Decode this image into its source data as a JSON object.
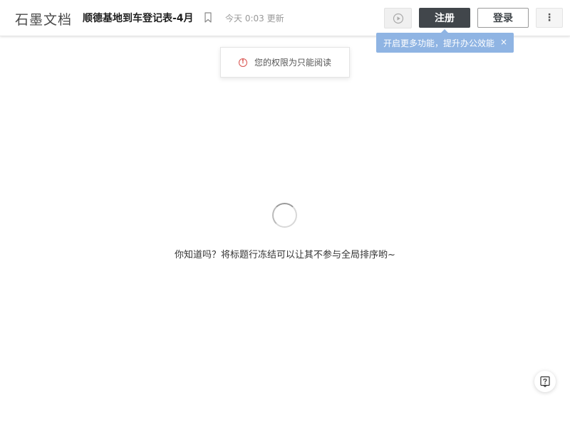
{
  "header": {
    "logo": "石墨文档",
    "doc_title": "顺德基地到车登记表-4月",
    "updated": "今天 0:03 更新",
    "register_label": "注册",
    "login_label": "登录",
    "more_glyph": "⋮"
  },
  "tooltip": {
    "text": "开启更多功能，提升办公效能",
    "close": "×"
  },
  "notice": {
    "icon_glyph": "!",
    "text": "您的权限为只能阅读"
  },
  "main": {
    "tip": "你知道吗？将标题行冻结可以让其不参与全局排序哟~"
  },
  "colors": {
    "register_bg": "#41464b",
    "tooltip_bg": "#8fb4e3",
    "notice_icon": "#d9534f"
  },
  "icons": {
    "bookmark": "bookmark-icon",
    "present": "play-circle-icon",
    "more": "more-vertical-icon",
    "help": "help-icon",
    "notice": "alert-circle-icon"
  }
}
